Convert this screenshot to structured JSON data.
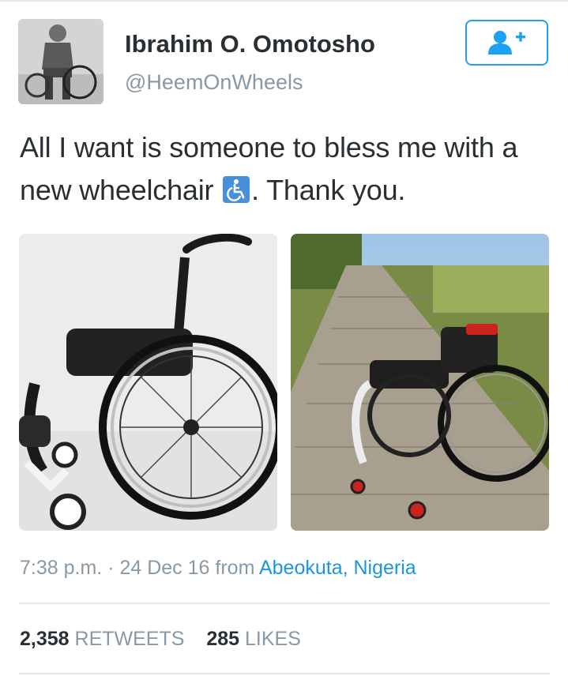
{
  "user": {
    "display_name": "Ibrahim O. Omotosho",
    "handle": "@HeemOnWheels",
    "avatar_icon": "person-in-wheelchair-photo"
  },
  "follow_button": {
    "icon": "add-user-icon",
    "color": "#1da1f2"
  },
  "tweet": {
    "text_before": "All I want is someone to bless me with a new wheelchair",
    "emoji": "wheelchair-symbol-icon",
    "text_after": ". Thank you."
  },
  "media": [
    {
      "description": "black sport wheelchair on white background"
    },
    {
      "description": "wheelchair on wooden boardwalk by the sea"
    }
  ],
  "meta": {
    "time": "7:38 p.m.",
    "separator": "·",
    "date": "24 Dec 16",
    "from_label": "from",
    "location": "Abeokuta, Nigeria"
  },
  "stats": {
    "retweets_count": "2,358",
    "retweets_label": "RETWEETS",
    "likes_count": "285",
    "likes_label": "LIKES"
  },
  "colors": {
    "accent": "#1da1f2",
    "link": "#1b95e0",
    "muted": "#8899a6",
    "text": "#292f33"
  }
}
